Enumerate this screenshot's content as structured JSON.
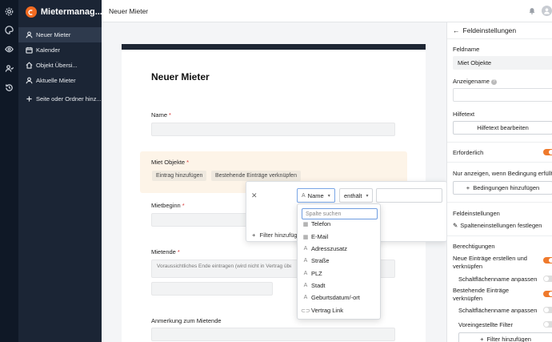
{
  "app": {
    "title": "Mietermanag...",
    "logo_icon": "app-logo-icon",
    "accent": "#f26b21"
  },
  "rail": {
    "icons": [
      "settings-icon",
      "palette-icon",
      "eye-icon",
      "users-icon",
      "history-icon"
    ]
  },
  "sidebar": {
    "items": [
      {
        "label": "Neuer Mieter",
        "icon": "user-icon",
        "active": true
      },
      {
        "label": "Kalender",
        "icon": "calendar-icon"
      },
      {
        "label": "Objekt Übersi...",
        "icon": "home-icon"
      },
      {
        "label": "Aktuelle Mieter",
        "icon": "user-icon"
      }
    ],
    "add_label": "Seite oder Ordner hinz..."
  },
  "topbar": {
    "title": "Neuer Mieter"
  },
  "form": {
    "title": "Neuer Mieter",
    "name_label": "Name",
    "miet_objekte_label": "Miet Objekte",
    "add_entry": "Eintrag hinzufügen",
    "link_existing": "Bestehende Einträge verknüpfen",
    "mietbeginn_label": "Mietbeginn",
    "mietende_label": "Mietende",
    "mietende_placeholder": "Voraussichtliches Ende eintragen (wird nicht in Vertrag übernommen)",
    "anmerkung_label": "Anmerkung zum Mietende",
    "required_mark": "*"
  },
  "filter": {
    "field": "Name",
    "operator": "enthält",
    "add_filter": "Filter hinzufüg"
  },
  "dropdown": {
    "search_placeholder": "Spalte suchen",
    "options": [
      {
        "label": "Telefon",
        "icon": "table-icon"
      },
      {
        "label": "E-Mail",
        "icon": "table-icon"
      },
      {
        "label": "Adresszusatz",
        "icon": "text-icon"
      },
      {
        "label": "Straße",
        "icon": "text-icon"
      },
      {
        "label": "PLZ",
        "icon": "text-icon"
      },
      {
        "label": "Stadt",
        "icon": "text-icon"
      },
      {
        "label": "Geburtsdatum/-ort",
        "icon": "text-icon"
      },
      {
        "label": "Vertrag Link",
        "icon": "link-icon"
      }
    ]
  },
  "panel": {
    "title": "Feldeinstellungen",
    "feldname_label": "Feldname",
    "feldname_value": "Miet Objekte",
    "anzeigename_label": "Anzeigename",
    "hilfetext_label": "Hilfetext",
    "hilfetext_button": "Hilfetext bearbeiten",
    "erforderlich_label": "Erforderlich",
    "bedingung_label": "Nur anzeigen, wenn Bedingung erfüllt ist",
    "bedingung_button": "Bedingungen hinzufügen",
    "feldeinstellungen_label": "Feldeinstellungen",
    "spalten_button": "Spalteneinstellungen festlegen",
    "berechtigungen_label": "Berechtigungen",
    "neue_eintraege_label": "Neue Einträge erstellen und verknüpfen",
    "schaltflaeche1_label": "Schaltflächenname anpassen",
    "bestehende_label": "Bestehende Einträge verknüpfen",
    "schaltflaeche2_label": "Schaltflächenname anpassen",
    "voreingestellte_label": "Voreingestellte Filter",
    "filter_button": "Filter hinzufügen"
  }
}
